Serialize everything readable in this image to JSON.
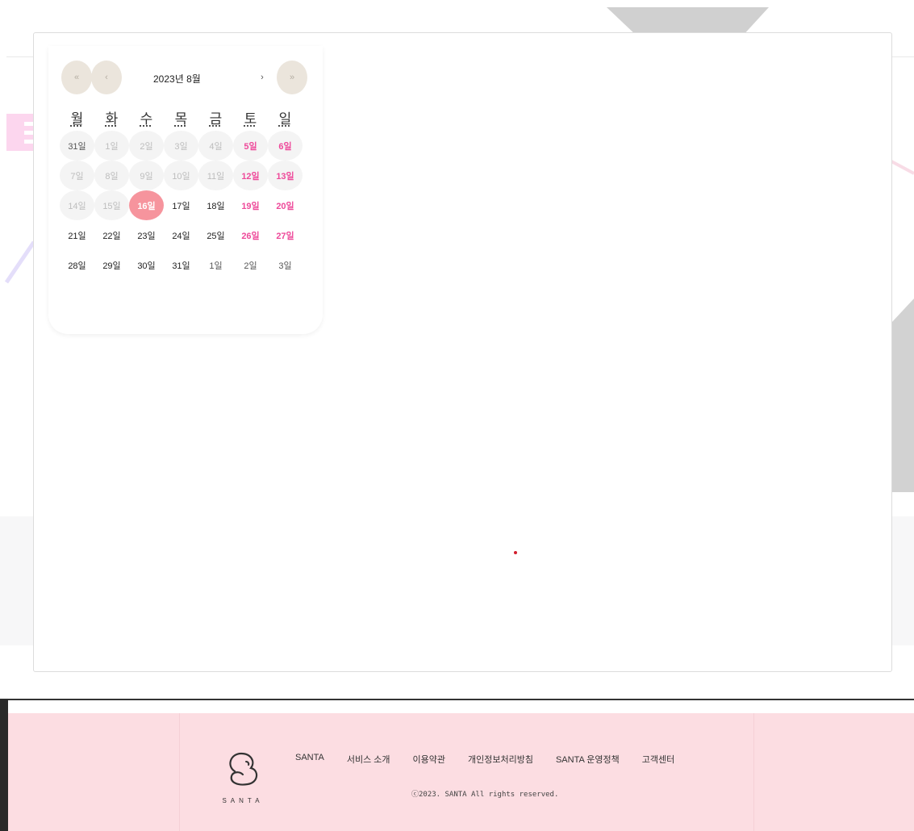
{
  "calendar": {
    "title": "2023년 8월",
    "nav": {
      "prev_year": "«",
      "prev_month": "‹",
      "next_month": "›",
      "next_year": "»"
    },
    "weekdays": [
      "월",
      "화",
      "수",
      "목",
      "금",
      "토",
      "일"
    ],
    "weeks": [
      [
        "31일",
        "1일",
        "2일",
        "3일",
        "4일",
        "5일",
        "6일"
      ],
      [
        "7일",
        "8일",
        "9일",
        "10일",
        "11일",
        "12일",
        "13일"
      ],
      [
        "14일",
        "15일",
        "16일",
        "17일",
        "18일",
        "19일",
        "20일"
      ],
      [
        "21일",
        "22일",
        "23일",
        "24일",
        "25일",
        "26일",
        "27일"
      ],
      [
        "28일",
        "29일",
        "30일",
        "31일",
        "1일",
        "2일",
        "3일"
      ]
    ],
    "selected": "16일"
  },
  "footer": {
    "logo_text": "SANTA",
    "links": [
      "SANTA",
      "서비스 소개",
      "이용약관",
      "개인정보처리방침",
      "SANTA 운영정책",
      "고객센터"
    ],
    "copyright": "ⓒ2023. SANTA All rights reserved."
  },
  "colors": {
    "accent": "#f6949d",
    "weekend": "#ee4a9a",
    "footer_bg": "#fcdde2",
    "nav_btn": "#ebe5dc"
  }
}
